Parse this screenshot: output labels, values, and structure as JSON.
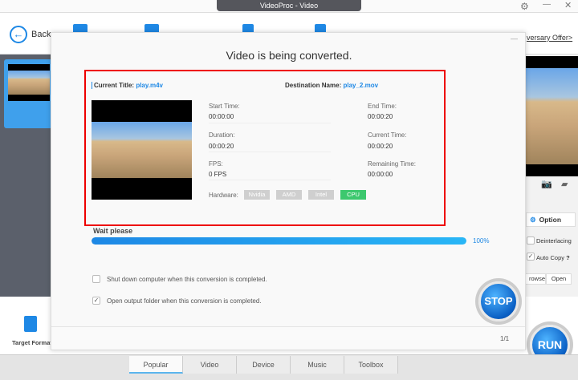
{
  "window": {
    "title": "VideoProc - Video"
  },
  "toolbar": {
    "back_label": "Back",
    "offer_label": "versary Offer>"
  },
  "sidebar": {
    "target_format_label": "Target Format"
  },
  "right_panel": {
    "option_label": "Option",
    "deinterlacing_label": "Deinterlacing",
    "auto_copy_label": "Auto Copy",
    "help": "?",
    "browse_label": "rowse",
    "open_label": "Open"
  },
  "run_label": "RUN",
  "tabs": [
    {
      "label": "Popular"
    },
    {
      "label": "Video"
    },
    {
      "label": "Device"
    },
    {
      "label": "Music"
    },
    {
      "label": "Toolbox"
    }
  ],
  "dialog": {
    "title": "Video is being converted.",
    "minimize": "—",
    "current_title_label": "Current Title:",
    "current_title": "play.m4v",
    "destination_label": "Destination Name:",
    "destination": "play_2.mov",
    "start_time_label": "Start Time:",
    "start_time": "00:00:00",
    "end_time_label": "End Time:",
    "end_time": "00:00:20",
    "duration_label": "Duration:",
    "duration": "00:00:20",
    "current_time_label": "Current Time:",
    "current_time": "00:00:20",
    "fps_label": "FPS:",
    "fps": "0 FPS",
    "remaining_label": "Remaining Time:",
    "remaining": "00:00:00",
    "hardware_label": "Hardware:",
    "hardware": [
      "Nvidia",
      "AMD",
      "Intel",
      "CPU"
    ],
    "hardware_active": "CPU",
    "status": "Wait please",
    "progress_percent": 100,
    "progress_text": "100%",
    "shutdown_label": "Shut down computer when this conversion is completed.",
    "shutdown_checked": false,
    "open_folder_label": "Open output folder when this conversion is completed.",
    "open_folder_checked": true,
    "stop_label": "STOP",
    "page": "1/1"
  },
  "colors": {
    "accent": "#1e88e5",
    "cpu_active": "#3cc86e",
    "highlight_box": "#e00000"
  }
}
